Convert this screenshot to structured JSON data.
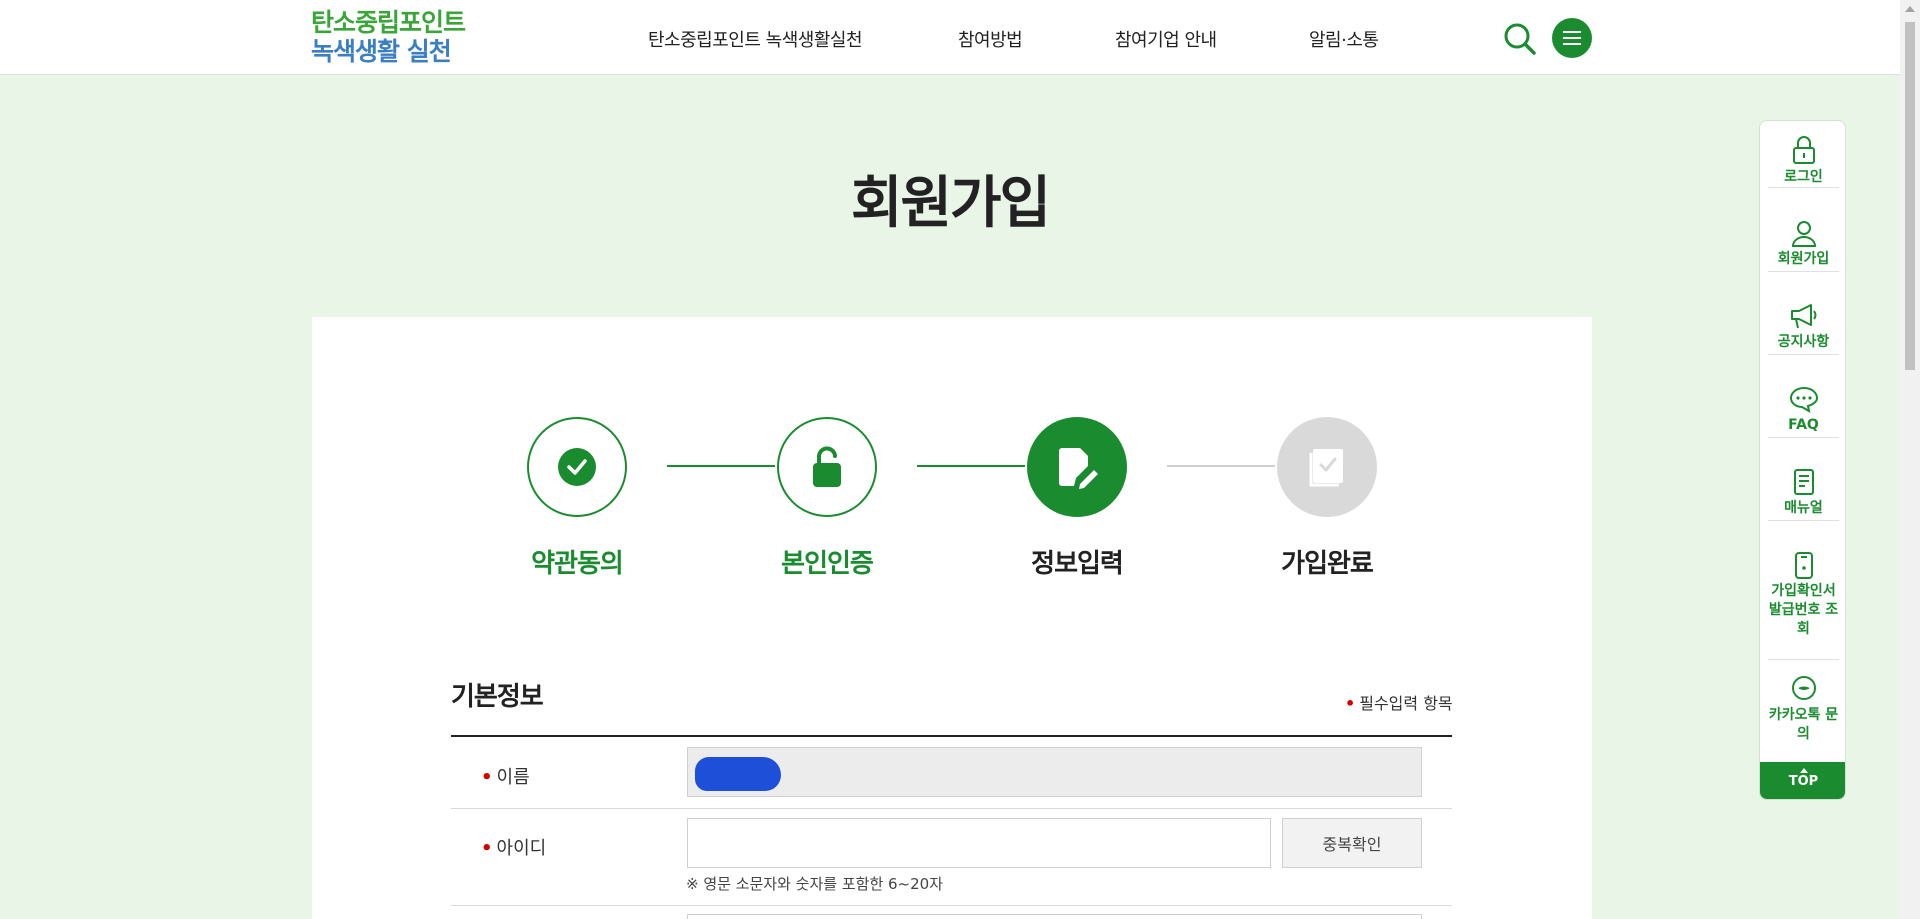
{
  "header": {
    "logo_line1": "탄소중립포인트",
    "logo_line2": "녹색생활 실천",
    "nav": [
      "탄소중립포인트 녹색생활실천",
      "참여방법",
      "참여기업 안내",
      "알림·소통"
    ]
  },
  "page_title": "회원가입",
  "steps": [
    {
      "label": "약관동의",
      "state": "done",
      "icon": "check-icon"
    },
    {
      "label": "본인인증",
      "state": "done",
      "icon": "unlock-icon"
    },
    {
      "label": "정보입력",
      "state": "active",
      "icon": "edit-document-icon"
    },
    {
      "label": "가입완료",
      "state": "todo",
      "icon": "completed-document-icon"
    }
  ],
  "form": {
    "section_title": "기본정보",
    "required_note": "필수입력 항목",
    "required_mark": "•",
    "fields": {
      "name_label": "이름",
      "id_label": "아이디",
      "id_dup_button": "중복확인",
      "id_hint": "※ 영문 소문자와 숫자를 포함한 6~20자"
    }
  },
  "quick_menu": {
    "items": [
      "로그인",
      "회원가입",
      "공지사항",
      "FAQ",
      "매뉴얼",
      "가입확인서 발급번호 조회",
      "카카오톡 문의"
    ],
    "top": "TOP"
  },
  "colors": {
    "brand_green": "#1a8c2f",
    "logo_green": "#3aa63a",
    "logo_blue": "#3b7ec4",
    "page_bg": "#e8f5e7",
    "required_red": "#d40000"
  }
}
